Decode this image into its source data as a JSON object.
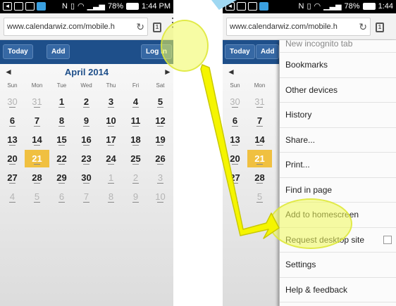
{
  "status_bar": {
    "battery_percent": "78%",
    "time_left": "1:44 PM",
    "time_right": "1:44"
  },
  "browser": {
    "url_left": "www.calendarwiz.com/mobile.h",
    "url_right": "www.calendarwiz.com/mobile.h",
    "tab_count": "1"
  },
  "app_bar": {
    "today_label": "Today",
    "add_label": "Add",
    "login_label": "Log In"
  },
  "calendar": {
    "title": "April 2014",
    "prev_arrow": "◄",
    "next_arrow": "►",
    "dow": [
      "Sun",
      "Mon",
      "Tue",
      "Wed",
      "Thu",
      "Fri",
      "Sat"
    ],
    "weeks": [
      [
        "30",
        "31",
        "1",
        "2",
        "3",
        "4",
        "5"
      ],
      [
        "6",
        "7",
        "8",
        "9",
        "10",
        "11",
        "12"
      ],
      [
        "13",
        "14",
        "15",
        "16",
        "17",
        "18",
        "19"
      ],
      [
        "20",
        "21",
        "22",
        "23",
        "24",
        "25",
        "26"
      ],
      [
        "27",
        "28",
        "29",
        "30",
        "1",
        "2",
        "3"
      ],
      [
        "4",
        "5",
        "6",
        "7",
        "8",
        "9",
        "10"
      ]
    ]
  },
  "menu": {
    "partial_item": "New incognito tab",
    "items": [
      "Bookmarks",
      "Other devices",
      "History",
      "Share...",
      "Print...",
      "Find in page",
      "Add to homescreen",
      "Request desktop site",
      "Settings",
      "Help & feedback"
    ]
  },
  "colors": {
    "app_bar": "#1e4f8a",
    "today": "#f0c040",
    "highlight": "#f0fa5a",
    "arrow": "#f5f500"
  }
}
